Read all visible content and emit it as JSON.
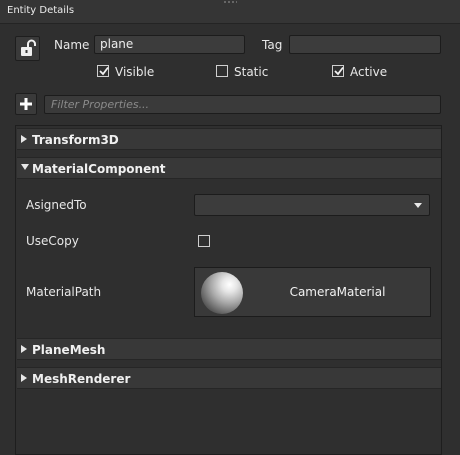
{
  "window": {
    "title": "Entity Details"
  },
  "entity": {
    "name_label": "Name",
    "name_value": "plane",
    "tag_label": "Tag",
    "tag_value": "",
    "visible_label": "Visible",
    "visible_checked": true,
    "static_label": "Static",
    "static_checked": false,
    "active_label": "Active",
    "active_checked": true
  },
  "filter": {
    "placeholder": "Filter Properties..."
  },
  "components": {
    "transform": {
      "title": "Transform3D",
      "expanded": false
    },
    "material": {
      "title": "MaterialComponent",
      "expanded": true,
      "asigned_to_label": "AsignedTo",
      "asigned_to_value": "",
      "use_copy_label": "UseCopy",
      "use_copy_checked": false,
      "material_path_label": "MaterialPath",
      "material_path_value": "CameraMaterial"
    },
    "planemesh": {
      "title": "PlaneMesh",
      "expanded": false
    },
    "meshrenderer": {
      "title": "MeshRenderer",
      "expanded": false
    }
  },
  "icons": {
    "lock": "unlock-icon",
    "add": "plus-icon",
    "collapsed": "triangle-right-icon",
    "expanded": "triangle-down-icon",
    "dropdown": "chevron-down-icon",
    "material_preview": "sphere-preview-icon"
  },
  "colors": {
    "background": "#2f2f2f",
    "field": "#3c3c3c",
    "section": "#383838",
    "text": "#e6e6e6"
  }
}
